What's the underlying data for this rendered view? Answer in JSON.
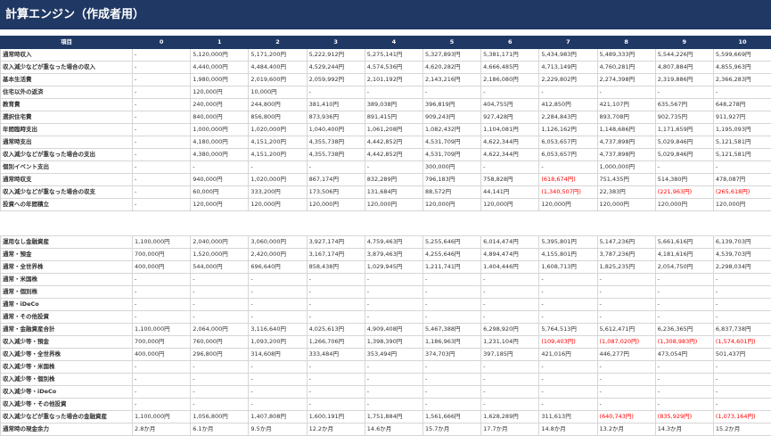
{
  "title": "計算エンジン（作成者用）",
  "header": [
    "項目",
    "0",
    "1",
    "2",
    "3",
    "4",
    "5",
    "6",
    "7",
    "8",
    "9",
    "10"
  ],
  "table1": [
    {
      "label": "通常時収入",
      "values": [
        "-",
        "5,120,000円",
        "5,171,200円",
        "5,222,912円",
        "5,275,141円",
        "5,327,893円",
        "5,381,171円",
        "5,434,983円",
        "5,489,333円",
        "5,544,226円",
        "5,599,669円"
      ]
    },
    {
      "label": "収入減少などが重なった場合の収入",
      "values": [
        "-",
        "4,440,000円",
        "4,484,400円",
        "4,529,244円",
        "4,574,536円",
        "4,620,282円",
        "4,666,485円",
        "4,713,149円",
        "4,760,281円",
        "4,807,884円",
        "4,855,963円"
      ]
    },
    {
      "label": "基本生活費",
      "values": [
        "-",
        "1,980,000円",
        "2,019,600円",
        "2,059,992円",
        "2,101,192円",
        "2,143,216円",
        "2,186,080円",
        "2,229,802円",
        "2,274,398円",
        "2,319,886円",
        "2,366,283円"
      ]
    },
    {
      "label": "住宅以外の返済",
      "values": [
        "-",
        "120,000円",
        "10,000円",
        "-",
        "-",
        "-",
        "-",
        "-",
        "-",
        "-",
        "-"
      ]
    },
    {
      "label": "教育費",
      "values": [
        "-",
        "240,000円",
        "244,800円",
        "381,410円",
        "389,038円",
        "396,819円",
        "404,755円",
        "412,850円",
        "421,107円",
        "635,567円",
        "648,278円"
      ]
    },
    {
      "label": "選択住宅費",
      "values": [
        "-",
        "840,000円",
        "856,800円",
        "873,936円",
        "891,415円",
        "909,243円",
        "927,428円",
        "2,284,843円",
        "893,708円",
        "902,735円",
        "911,927円"
      ]
    },
    {
      "label": "年間臨時支出",
      "values": [
        "-",
        "1,000,000円",
        "1,020,000円",
        "1,040,400円",
        "1,061,208円",
        "1,082,432円",
        "1,104,081円",
        "1,126,162円",
        "1,148,686円",
        "1,171,659円",
        "1,195,093円"
      ]
    },
    {
      "label": "通常時支出",
      "values": [
        "-",
        "4,180,000円",
        "4,151,200円",
        "4,355,738円",
        "4,442,852円",
        "4,531,709円",
        "4,622,344円",
        "6,053,657円",
        "4,737,898円",
        "5,029,846円",
        "5,121,581円"
      ]
    },
    {
      "label": "収入減少などが重なった場合の支出",
      "values": [
        "-",
        "4,380,000円",
        "4,151,200円",
        "4,355,738円",
        "4,442,852円",
        "4,531,709円",
        "4,622,344円",
        "6,053,657円",
        "4,737,898円",
        "5,029,846円",
        "5,121,581円"
      ]
    },
    {
      "label": "個別イベント支出",
      "values": [
        "-",
        "-",
        "-",
        "-",
        "-",
        "300,000円",
        "-",
        "-",
        "1,000,000円",
        "-",
        "-"
      ]
    },
    {
      "label": "通常時収支",
      "values": [
        "-",
        "940,000円",
        "1,020,000円",
        "867,174円",
        "832,289円",
        "796,183円",
        "758,828円",
        "(618,674円)",
        "751,435円",
        "514,380円",
        "478,087円"
      ]
    },
    {
      "label": "収入減少などが重なった場合の収支",
      "values": [
        "-",
        "60,000円",
        "333,200円",
        "173,506円",
        "131,684円",
        "88,572円",
        "44,141円",
        "(1,340,507円)",
        "22,383円",
        "(221,963円)",
        "(265,618円)"
      ]
    },
    {
      "label": "投資への年間積立",
      "values": [
        "-",
        "120,000円",
        "120,000円",
        "120,000円",
        "120,000円",
        "120,000円",
        "120,000円",
        "120,000円",
        "120,000円",
        "120,000円",
        "120,000円"
      ]
    }
  ],
  "table2": [
    {
      "label": "運用なし金融資産",
      "values": [
        "1,100,000円",
        "2,040,000円",
        "3,060,000円",
        "3,927,174円",
        "4,759,463円",
        "5,255,646円",
        "6,014,474円",
        "5,395,801円",
        "5,147,236円",
        "5,661,616円",
        "6,139,703円"
      ]
    },
    {
      "label": "通常・預金",
      "values": [
        "700,000円",
        "1,520,000円",
        "2,420,000円",
        "3,167,174円",
        "3,879,463円",
        "4,255,646円",
        "4,894,474円",
        "4,155,801円",
        "3,787,236円",
        "4,181,616円",
        "4,539,703円"
      ]
    },
    {
      "label": "通常・全世界株",
      "values": [
        "400,000円",
        "544,000円",
        "696,640円",
        "858,438円",
        "1,029,945円",
        "1,211,741円",
        "1,404,446円",
        "1,608,713円",
        "1,825,235円",
        "2,054,750円",
        "2,298,034円"
      ]
    },
    {
      "label": "通常・米国株",
      "values": [
        "-",
        "-",
        "-",
        "-",
        "-",
        "-",
        "-",
        "-",
        "-",
        "-",
        "-"
      ]
    },
    {
      "label": "通常・個別株",
      "values": [
        "-",
        "-",
        "-",
        "-",
        "-",
        "-",
        "-",
        "-",
        "-",
        "-",
        "-"
      ]
    },
    {
      "label": "通常・iDeCo",
      "values": [
        "-",
        "-",
        "-",
        "-",
        "-",
        "-",
        "-",
        "-",
        "-",
        "-",
        "-"
      ]
    },
    {
      "label": "通常・その他投資",
      "values": [
        "-",
        "-",
        "-",
        "-",
        "-",
        "-",
        "-",
        "-",
        "-",
        "-",
        "-"
      ]
    },
    {
      "label": "通常・金融資産合計",
      "values": [
        "1,100,000円",
        "2,064,000円",
        "3,116,640円",
        "4,025,613円",
        "4,909,408円",
        "5,467,388円",
        "6,298,920円",
        "5,764,513円",
        "5,612,471円",
        "6,236,365円",
        "6,837,738円"
      ]
    },
    {
      "label": "収入減少等・預金",
      "values": [
        "700,000円",
        "760,000円",
        "1,093,200円",
        "1,266,706円",
        "1,398,390円",
        "1,186,963円",
        "1,231,104円",
        "(109,403円)",
        "(1,087,020円)",
        "(1,308,983円)",
        "(1,574,601円)"
      ]
    },
    {
      "label": "収入減少等・全世界株",
      "values": [
        "400,000円",
        "296,800円",
        "314,608円",
        "333,484円",
        "353,494円",
        "374,703円",
        "397,185円",
        "421,016円",
        "446,277円",
        "473,054円",
        "501,437円"
      ]
    },
    {
      "label": "収入減少等・米国株",
      "values": [
        "-",
        "-",
        "-",
        "-",
        "-",
        "-",
        "-",
        "-",
        "-",
        "-",
        "-"
      ]
    },
    {
      "label": "収入減少等・個別株",
      "values": [
        "-",
        "-",
        "-",
        "-",
        "-",
        "-",
        "-",
        "-",
        "-",
        "-",
        "-"
      ]
    },
    {
      "label": "収入減少等・iDeCo",
      "values": [
        "-",
        "-",
        "-",
        "-",
        "-",
        "-",
        "-",
        "-",
        "-",
        "-",
        "-"
      ]
    },
    {
      "label": "収入減少等・その他投資",
      "values": [
        "-",
        "-",
        "-",
        "-",
        "-",
        "-",
        "-",
        "-",
        "-",
        "-",
        "-"
      ]
    },
    {
      "label": "収入減少などが重なった場合の金融資産",
      "values": [
        "1,100,000円",
        "1,056,800円",
        "1,407,808円",
        "1,600,191円",
        "1,751,884円",
        "1,561,666円",
        "1,628,289円",
        "311,613円",
        "(640,743円)",
        "(835,929円)",
        "(1,073,164円)"
      ]
    },
    {
      "label": "通常時の現金余力",
      "values": [
        "2.8か月",
        "6.1か月",
        "9.5か月",
        "12.2か月",
        "14.6か月",
        "15.7か月",
        "17.7か月",
        "14.8か月",
        "13.2か月",
        "14.3か月",
        "15.2か月"
      ]
    }
  ]
}
